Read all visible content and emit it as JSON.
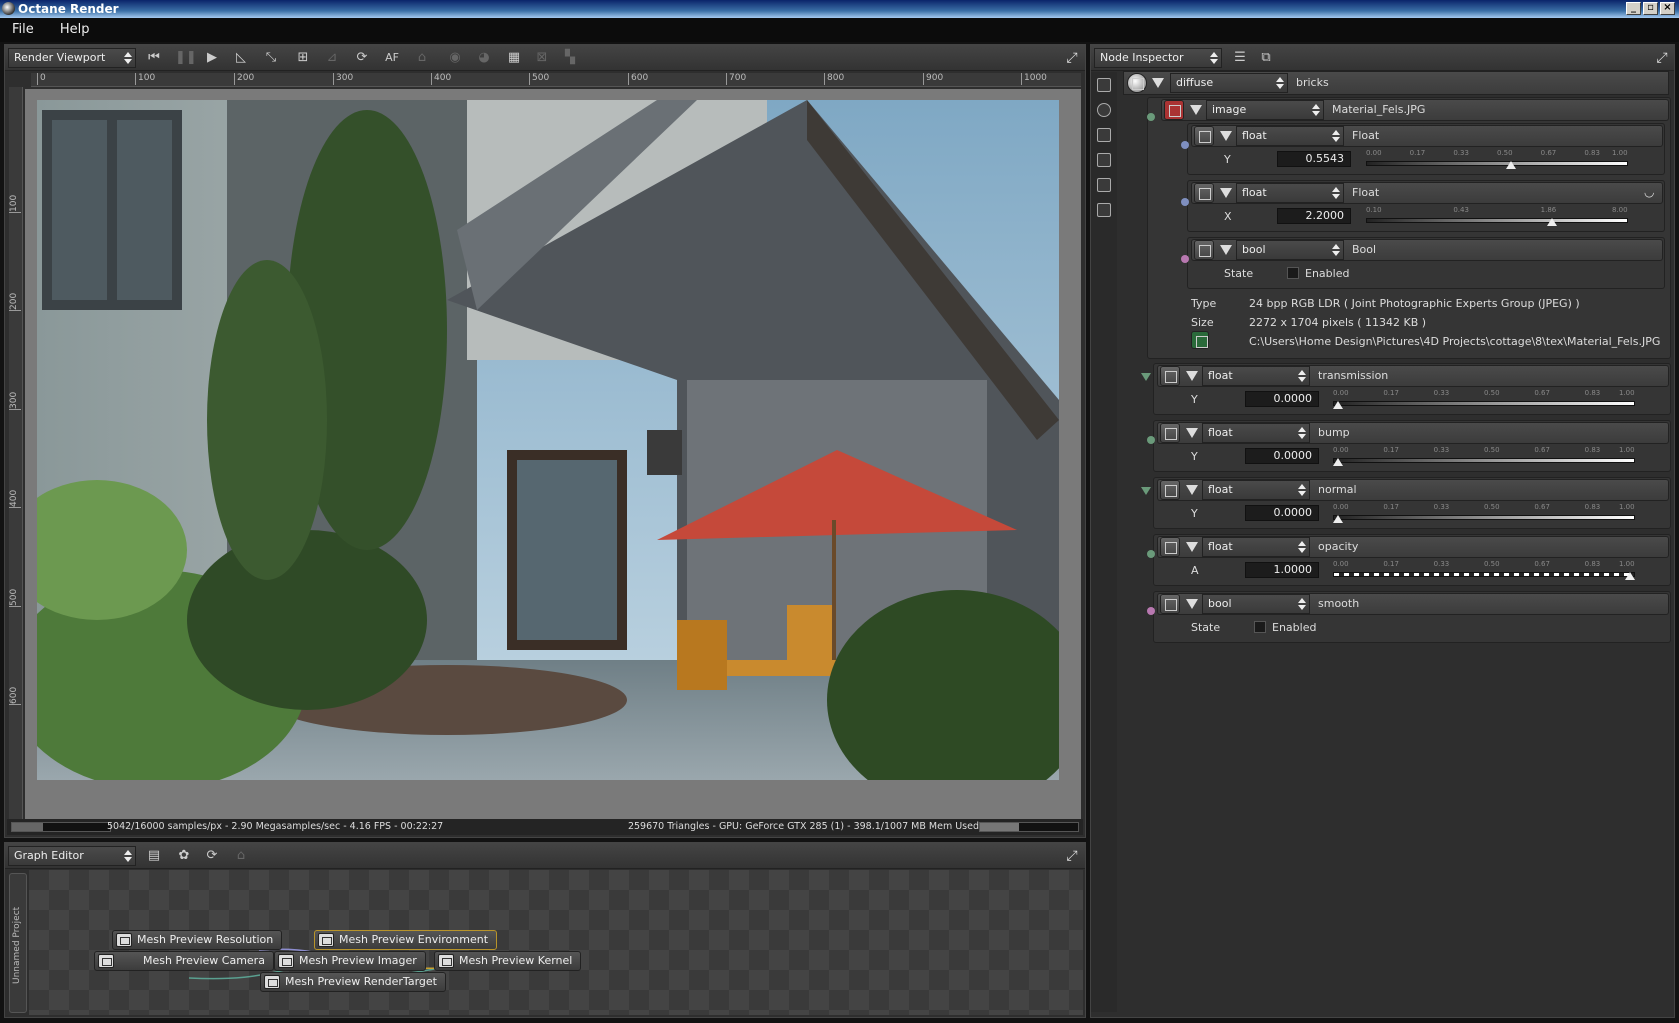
{
  "window": {
    "title": "Octane Render"
  },
  "menu": [
    "File",
    "Help"
  ],
  "viewport": {
    "selector": "Render Viewport",
    "ruler_top": [
      "0",
      "100",
      "200",
      "300",
      "400",
      "500",
      "600",
      "700",
      "800",
      "900",
      "1000"
    ],
    "ruler_left": [
      "100",
      "200",
      "300",
      "400",
      "500",
      "600"
    ],
    "status_left": "5042/16000 samples/px - 2.90 Megasamples/sec - 4.16 FPS - 00:22:27",
    "status_right": "259670 Triangles - GPU: GeForce GTX 285 (1) - 398.1/1007 MB Mem Used",
    "progress": 0.315,
    "mem_used": 0.395,
    "toolbar_text": "AF"
  },
  "graph_editor": {
    "selector": "Graph Editor",
    "project_tab": "Unnamed Project",
    "nodes": [
      "Mesh Preview Resolution",
      "Mesh Preview Environment",
      "Mesh Preview Camera",
      "Mesh Preview Imager",
      "Mesh Preview Kernel",
      "Mesh Preview RenderTarget"
    ]
  },
  "inspector": {
    "selector": "Node Inspector",
    "root": {
      "type": "diffuse",
      "name": "bricks"
    },
    "image": {
      "type": "image",
      "name": "Material_Fels.JPG"
    },
    "float1": {
      "type": "float",
      "name": "Float",
      "axis": "Y",
      "value": "0.5543",
      "ticks": [
        "0.00",
        "0.17",
        "0.33",
        "0.50",
        "0.67",
        "0.83",
        "1.00"
      ],
      "pos": 0.5543
    },
    "float2": {
      "type": "float",
      "name": "Float",
      "axis": "X",
      "value": "2.2000",
      "ticks": [
        "0.10",
        "0.43",
        "1.86",
        "8.00"
      ],
      "pos": 0.72
    },
    "bool1": {
      "type": "bool",
      "name": "Bool",
      "state_label": "State",
      "state": "Enabled"
    },
    "info": {
      "type_label": "Type",
      "type_value": "24 bpp RGB LDR ( Joint Photographic Experts Group (JPEG) )",
      "size_label": "Size",
      "size_value": "2272 x 1704 pixels ( 11342 KB )",
      "path": "C:\\Users\\Home Design\\Pictures\\4D Projects\\cottage\\8\\tex\\Material_Fels.JPG"
    },
    "transmission": {
      "type": "float",
      "name": "transmission",
      "axis": "Y",
      "value": "0.0000",
      "pos": 0
    },
    "bump": {
      "type": "float",
      "name": "bump",
      "axis": "Y",
      "value": "0.0000",
      "pos": 0
    },
    "normal": {
      "type": "float",
      "name": "normal",
      "axis": "Y",
      "value": "0.0000",
      "pos": 0
    },
    "opacity": {
      "type": "float",
      "name": "opacity",
      "axis": "A",
      "value": "1.0000",
      "pos": 1
    },
    "smooth": {
      "type": "bool",
      "name": "smooth",
      "state_label": "State",
      "state": "Enabled"
    },
    "std_ticks": [
      "0.00",
      "0.17",
      "0.33",
      "0.50",
      "0.67",
      "0.83",
      "1.00"
    ]
  },
  "colors": {
    "accent_selected": "#b8942a",
    "pin_green": "#6a9a7a",
    "pin_blue": "#7f8fbf",
    "pin_pink": "#b878b0"
  }
}
